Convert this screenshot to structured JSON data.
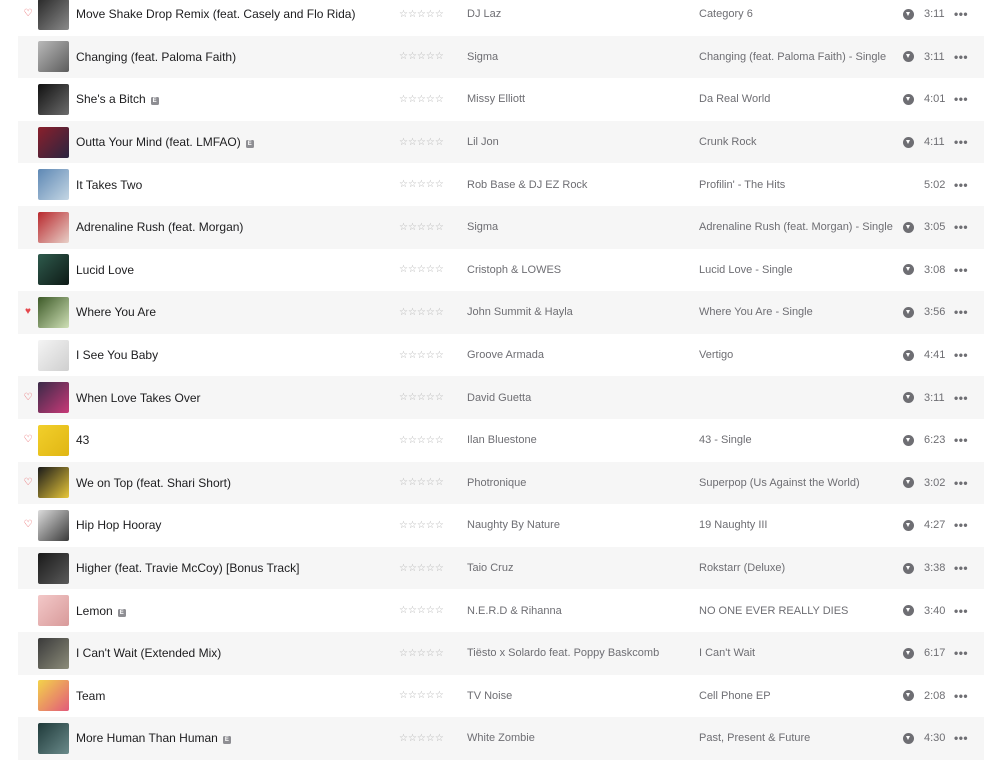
{
  "colors": {
    "heart": "#e5484d",
    "row_alt": "#f6f6f6",
    "text_secondary": "#6e6e73"
  },
  "rating_glyph": "☆☆☆☆☆",
  "more_glyph": "•••",
  "explicit_glyph": "E",
  "tracks": [
    {
      "title": "Move Shake Drop Remix (feat. Casely and Flo Rida)",
      "explicit": false,
      "heart": "outline",
      "artist": "DJ Laz",
      "album": "Category 6",
      "duration": "3:11",
      "downloaded": true,
      "art": [
        "#2a2a2a",
        "#8a8a8a"
      ]
    },
    {
      "title": "Changing (feat. Paloma Faith)",
      "explicit": false,
      "heart": "none",
      "artist": "Sigma",
      "album": "Changing (feat. Paloma Faith) - Single",
      "duration": "3:11",
      "downloaded": true,
      "art": [
        "#b9b9b9",
        "#5c5c5c"
      ]
    },
    {
      "title": "She's a Bitch",
      "explicit": true,
      "heart": "none",
      "artist": "Missy Elliott",
      "album": "Da Real World",
      "duration": "4:01",
      "downloaded": true,
      "art": [
        "#111111",
        "#6c6c6c"
      ]
    },
    {
      "title": "Outta Your Mind (feat. LMFAO)",
      "explicit": true,
      "heart": "none",
      "artist": "Lil Jon",
      "album": "Crunk Rock",
      "duration": "4:11",
      "downloaded": true,
      "art": [
        "#8a1f2b",
        "#2a2540"
      ]
    },
    {
      "title": "It Takes Two",
      "explicit": false,
      "heart": "none",
      "artist": "Rob Base & DJ EZ Rock",
      "album": "Profilin' - The Hits",
      "duration": "5:02",
      "downloaded": false,
      "art": [
        "#5e88b4",
        "#c4d6e4"
      ]
    },
    {
      "title": "Adrenaline Rush (feat. Morgan)",
      "explicit": false,
      "heart": "none",
      "artist": "Sigma",
      "album": "Adrenaline Rush (feat. Morgan) - Single",
      "duration": "3:05",
      "downloaded": true,
      "art": [
        "#b8282d",
        "#e8d0c8"
      ]
    },
    {
      "title": "Lucid Love",
      "explicit": false,
      "heart": "none",
      "artist": "Cristoph & LOWES",
      "album": "Lucid Love - Single",
      "duration": "3:08",
      "downloaded": true,
      "art": [
        "#2e5a4c",
        "#0e1a16"
      ]
    },
    {
      "title": "Where You Are",
      "explicit": false,
      "heart": "filled",
      "artist": "John Summit & Hayla",
      "album": "Where You Are - Single",
      "duration": "3:56",
      "downloaded": true,
      "art": [
        "#3d5a28",
        "#cfe0b6"
      ]
    },
    {
      "title": "I See You Baby",
      "explicit": false,
      "heart": "none",
      "artist": "Groove Armada",
      "album": "Vertigo",
      "duration": "4:41",
      "downloaded": true,
      "art": [
        "#f4f4f4",
        "#cfcfcf"
      ]
    },
    {
      "title": "When Love Takes Over",
      "explicit": false,
      "heart": "outline",
      "artist": "David Guetta",
      "album": "",
      "duration": "3:11",
      "downloaded": true,
      "art": [
        "#3a2a48",
        "#c83a78"
      ]
    },
    {
      "title": "43",
      "explicit": false,
      "heart": "outline",
      "artist": "Ilan Bluestone",
      "album": "43 - Single",
      "duration": "6:23",
      "downloaded": true,
      "art": [
        "#f2cf2b",
        "#e0b614"
      ]
    },
    {
      "title": "We on Top (feat. Shari Short)",
      "explicit": false,
      "heart": "outline",
      "artist": "Photronique",
      "album": "Superpop (Us Against the World)",
      "duration": "3:02",
      "downloaded": true,
      "art": [
        "#1a1a1a",
        "#e8c73a"
      ]
    },
    {
      "title": "Hip Hop Hooray",
      "explicit": false,
      "heart": "outline",
      "artist": "Naughty By Nature",
      "album": "19 Naughty III",
      "duration": "4:27",
      "downloaded": true,
      "art": [
        "#dcdcdc",
        "#3a3a3a"
      ]
    },
    {
      "title": "Higher (feat. Travie McCoy) [Bonus Track]",
      "explicit": false,
      "heart": "none",
      "artist": "Taio Cruz",
      "album": "Rokstarr (Deluxe)",
      "duration": "3:38",
      "downloaded": true,
      "art": [
        "#1a1a1a",
        "#5a5a5a"
      ]
    },
    {
      "title": "Lemon",
      "explicit": true,
      "heart": "none",
      "artist": "N.E.R.D & Rihanna",
      "album": "NO ONE EVER REALLY DIES",
      "duration": "3:40",
      "downloaded": true,
      "art": [
        "#f3c8c8",
        "#d89a9a"
      ]
    },
    {
      "title": "I Can't Wait (Extended Mix)",
      "explicit": false,
      "heart": "none",
      "artist": "Tiësto x Solardo feat. Poppy Baskcomb",
      "album": "I Can't Wait",
      "duration": "6:17",
      "downloaded": true,
      "art": [
        "#3a3a3a",
        "#8c8c7a"
      ]
    },
    {
      "title": "Team",
      "explicit": false,
      "heart": "none",
      "artist": "TV Noise",
      "album": "Cell Phone EP",
      "duration": "2:08",
      "downloaded": true,
      "art": [
        "#f3d34a",
        "#e25a7a"
      ]
    },
    {
      "title": "More Human Than Human",
      "explicit": true,
      "heart": "none",
      "artist": "White Zombie",
      "album": "Past, Present & Future",
      "duration": "4:30",
      "downloaded": true,
      "art": [
        "#1f3a3a",
        "#6a8a8a"
      ]
    }
  ]
}
